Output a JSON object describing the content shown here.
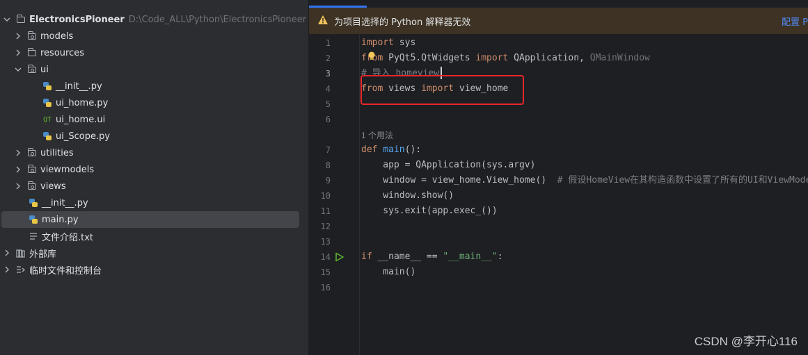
{
  "project": {
    "name": "ElectronicsPioneer",
    "path": "D:\\Code_ALL\\Python\\ElectronicsPioneer"
  },
  "tree": {
    "models": "models",
    "resources": "resources",
    "ui": "ui",
    "ui_init": "__init__.py",
    "ui_home_py": "ui_home.py",
    "ui_home_ui": "ui_home.ui",
    "ui_scope": "ui_Scope.py",
    "utilities": "utilities",
    "viewmodels": "viewmodels",
    "views": "views",
    "root_init": "__init__.py",
    "main": "main.py",
    "intro": "文件介绍.txt",
    "external": "外部库",
    "scratches": "临时文件和控制台"
  },
  "banner": {
    "text": "为项目选择的 Python 解释器无效",
    "action": "配置 P"
  },
  "editor": {
    "line_numbers": [
      "1",
      "2",
      "3",
      "4",
      "5",
      "6",
      "7",
      "8",
      "9",
      "10",
      "11",
      "12",
      "13",
      "14",
      "15",
      "16"
    ],
    "usage_hint": "1 个用法",
    "code": {
      "l1_kw": "import",
      "l1_rest": " sys",
      "l2_kw": "from",
      "l2_mod": " PyQt5.QtWidgets ",
      "l2_kw2": "import",
      "l2_a": " QApplication, ",
      "l2_dim": "QMainWindow",
      "l3_cm": "# 导入 homeview",
      "l4_kw": "from",
      "l4_mod": " views ",
      "l4_kw2": "import",
      "l4_rest": " view_home",
      "l7_kw": "def ",
      "l7_fn": "main",
      "l7_rest": "():",
      "l8": "    app = QApplication(sys.argv)",
      "l9_code": "    window = view_home.View_home()  ",
      "l9_cm": "# 假设HomeView在其构造函数中设置了所有的UI和ViewModel",
      "l10": "    window.show()",
      "l11": "    sys.exit(app.exec_())",
      "l14_kw": "if",
      "l14_mid": " __name__ == ",
      "l14_str": "\"__main__\"",
      "l14_end": ":",
      "l15": "    main()"
    }
  },
  "watermark": "CSDN @李开心116",
  "colors": {
    "accent": "#3574f0",
    "highlight_box": "#e8262d",
    "banner_bg": "#3d3223"
  }
}
